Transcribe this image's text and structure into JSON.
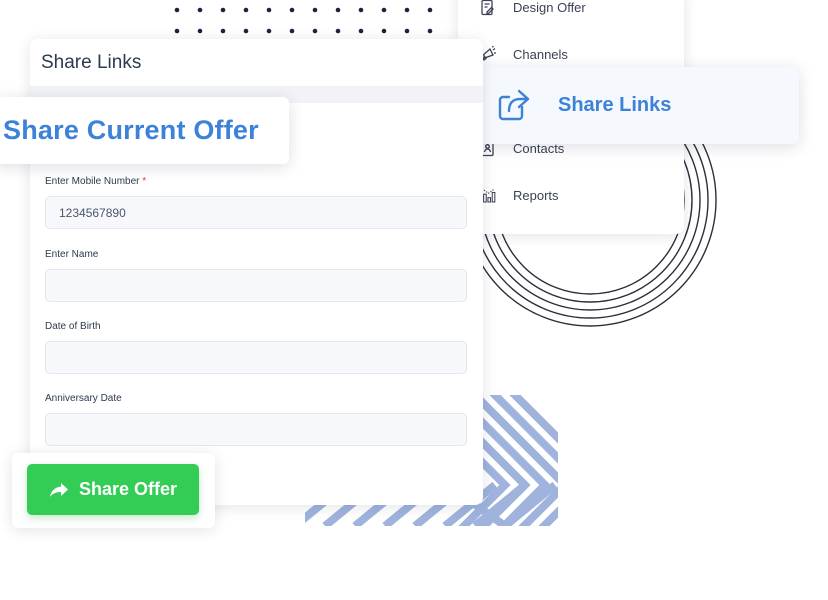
{
  "main_card": {
    "title": "Share Links"
  },
  "floating_title": "Share Current Offer",
  "form": {
    "mobile": {
      "label": "Enter Mobile Number",
      "required_mark": "*",
      "value": "1234567890"
    },
    "name": {
      "label": "Enter Name",
      "value": ""
    },
    "dob": {
      "label": "Date of Birth",
      "value": ""
    },
    "anniversary": {
      "label": "Anniversary Date",
      "value": ""
    }
  },
  "share_button": {
    "label": "Share Offer",
    "icon": "share-arrow-icon",
    "color": "#33cc55"
  },
  "menu": {
    "items": [
      {
        "label": "Design Offer",
        "icon": "design-offer-icon"
      },
      {
        "label": "Channels",
        "icon": "megaphone-icon"
      },
      {
        "label": "Contacts",
        "icon": "contacts-icon"
      },
      {
        "label": "Reports",
        "icon": "reports-icon"
      }
    ],
    "highlighted": {
      "label": "Share Links",
      "icon": "share-links-icon",
      "color": "#3c82d8"
    }
  }
}
